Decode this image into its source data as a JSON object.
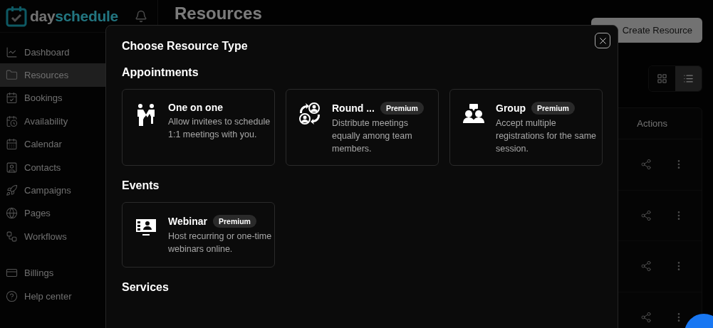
{
  "logo": {
    "prefix": "day",
    "suffix": "schedule"
  },
  "sidebar": {
    "items": [
      {
        "label": "Dashboard",
        "selected": false
      },
      {
        "label": "Resources",
        "selected": true
      },
      {
        "label": "Bookings",
        "selected": false
      },
      {
        "label": "Availability",
        "selected": false
      },
      {
        "label": "Calendar",
        "selected": false
      },
      {
        "label": "Contacts",
        "selected": false
      },
      {
        "label": "Campaigns",
        "selected": false
      },
      {
        "label": "Pages",
        "selected": false
      },
      {
        "label": "Workflows",
        "selected": false
      }
    ],
    "bottom_items": [
      {
        "label": "Billings",
        "selected": false
      },
      {
        "label": "Help center",
        "selected": false
      }
    ]
  },
  "page": {
    "title": "Resources",
    "create_button": "Create Resource",
    "view_toggle": [
      {
        "selected": false
      },
      {
        "selected": true
      }
    ],
    "table": {
      "columns": [
        "Actions"
      ]
    }
  },
  "modal": {
    "title": "Choose Resource Type",
    "sections": [
      {
        "title": "Appointments",
        "cards": [
          {
            "kind": "one-on-one",
            "title": "One on one",
            "description": "Allow invitees to schedule 1:1 meetings with you."
          },
          {
            "kind": "round-robin",
            "title": "Round ...",
            "badge": "Premium",
            "description": "Distribute meetings equally among team members."
          },
          {
            "kind": "group",
            "title": "Group",
            "badge": "Premium",
            "description": "Accept multiple registrations for the same session."
          }
        ]
      },
      {
        "title": "Events",
        "cards": [
          {
            "kind": "webinar",
            "title": "Webinar",
            "badge": "Premium",
            "description": "Host recurring or one-time webinars online."
          }
        ]
      },
      {
        "title": "Services"
      }
    ]
  }
}
